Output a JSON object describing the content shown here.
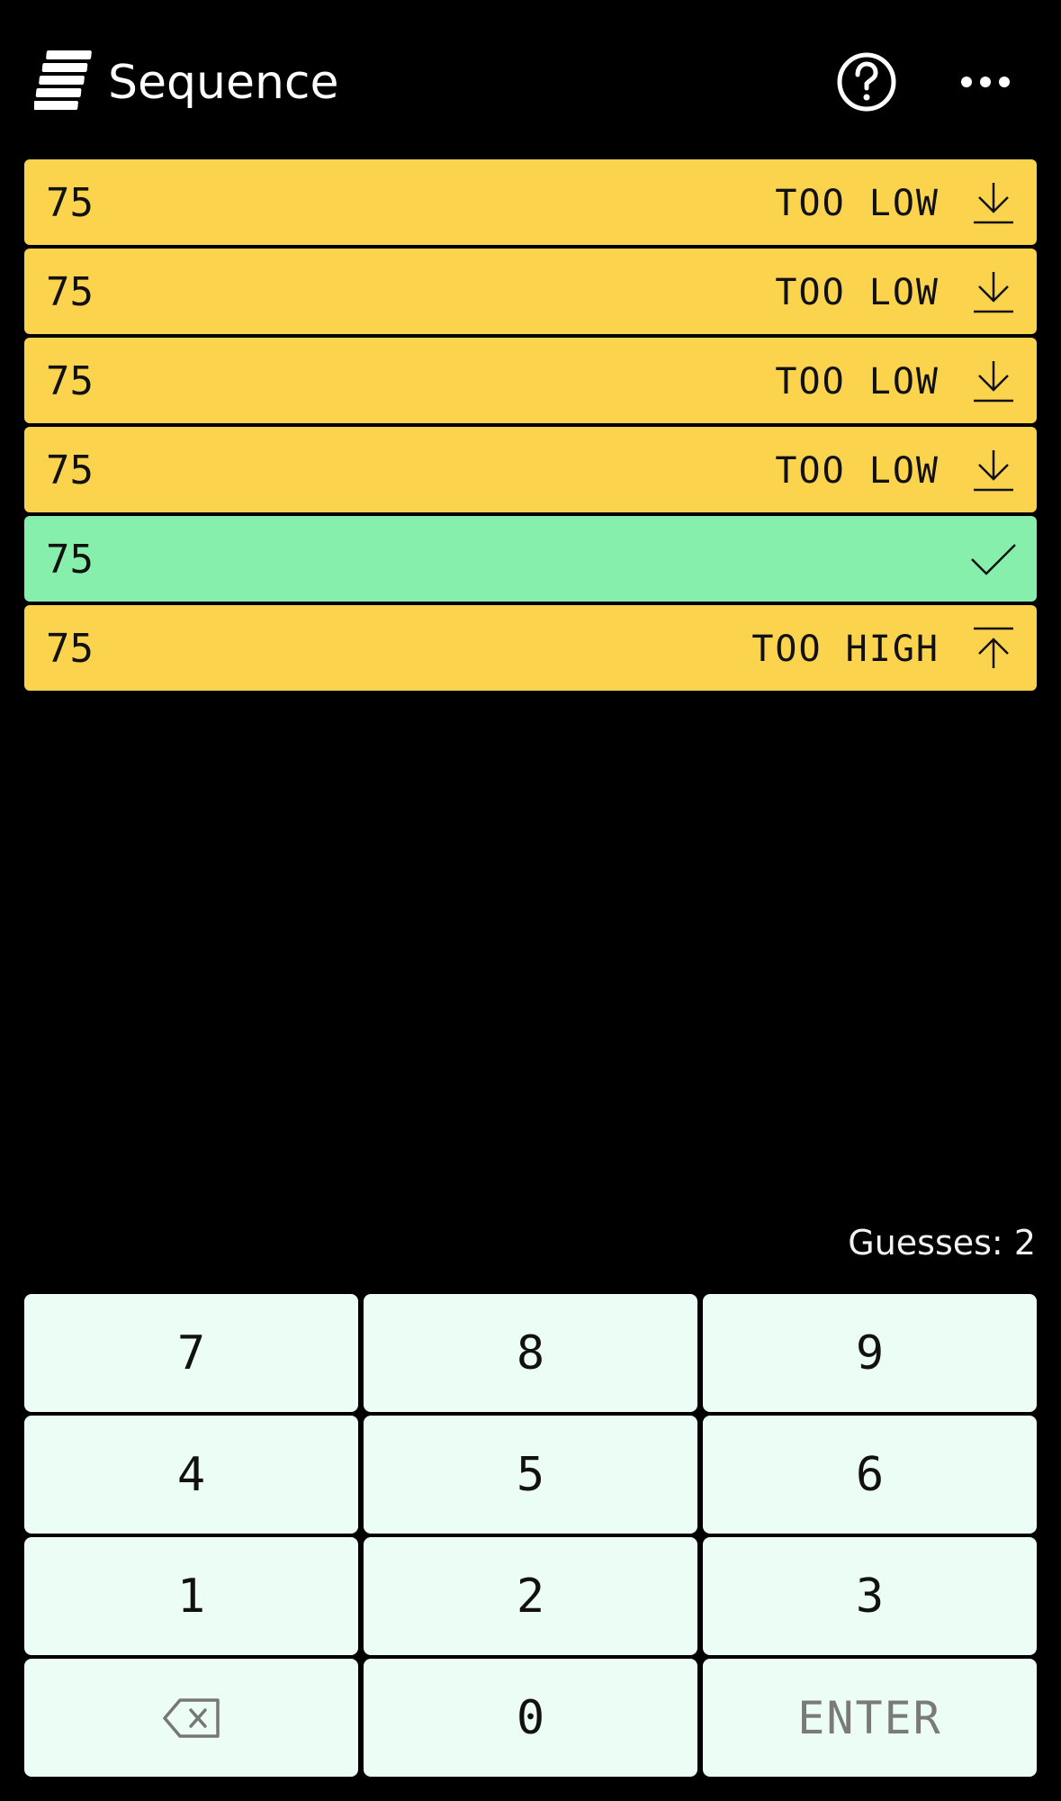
{
  "header": {
    "title": "Sequence",
    "logo_icon": "stacked-bars-logo",
    "help_icon": "question-circle-icon",
    "menu_icon": "more-horizontal-icon"
  },
  "guesses": [
    {
      "value": "75",
      "status": "TOO LOW",
      "result": "low",
      "icon": "arrow-down-to-line-icon"
    },
    {
      "value": "75",
      "status": "TOO LOW",
      "result": "low",
      "icon": "arrow-down-to-line-icon"
    },
    {
      "value": "75",
      "status": "TOO LOW",
      "result": "low",
      "icon": "arrow-down-to-line-icon"
    },
    {
      "value": "75",
      "status": "TOO LOW",
      "result": "low",
      "icon": "arrow-down-to-line-icon"
    },
    {
      "value": "75",
      "status": "",
      "result": "correct",
      "icon": "checkmark-icon"
    },
    {
      "value": "75",
      "status": "TOO HIGH",
      "result": "high",
      "icon": "arrow-up-from-line-icon"
    }
  ],
  "counter": {
    "text": "Guesses: 2"
  },
  "keypad": {
    "keys": [
      "7",
      "8",
      "9",
      "4",
      "5",
      "6",
      "1",
      "2",
      "3"
    ],
    "zero": "0",
    "enter": "ENTER",
    "backspace_icon": "backspace-icon"
  },
  "colors": {
    "background": "#000000",
    "too_far": "#fcd34d",
    "correct": "#86efac",
    "key": "#ecfdf5"
  }
}
